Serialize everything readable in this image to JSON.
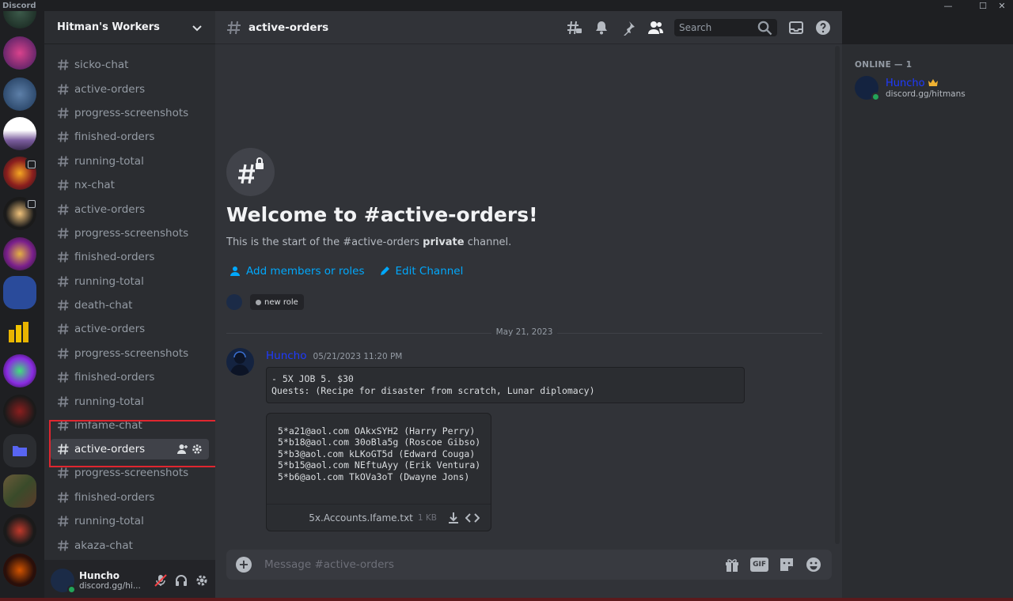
{
  "app": {
    "title": "Discord"
  },
  "guild": {
    "name": "Hitman's Workers"
  },
  "channels": [
    {
      "label": "sicko-chat"
    },
    {
      "label": "active-orders"
    },
    {
      "label": "progress-screenshots"
    },
    {
      "label": "finished-orders"
    },
    {
      "label": "running-total"
    },
    {
      "label": "nx-chat"
    },
    {
      "label": "active-orders"
    },
    {
      "label": "progress-screenshots"
    },
    {
      "label": "finished-orders"
    },
    {
      "label": "running-total"
    },
    {
      "label": "death-chat"
    },
    {
      "label": "active-orders"
    },
    {
      "label": "progress-screenshots"
    },
    {
      "label": "finished-orders"
    },
    {
      "label": "running-total"
    },
    {
      "label": "imfame-chat"
    },
    {
      "label": "active-orders",
      "active": true
    },
    {
      "label": "progress-screenshots"
    },
    {
      "label": "finished-orders"
    },
    {
      "label": "running-total"
    },
    {
      "label": "akaza-chat"
    }
  ],
  "user": {
    "name": "Huncho",
    "status": "discord.gg/hi..."
  },
  "header": {
    "channel": "active-orders",
    "search_placeholder": "Search"
  },
  "welcome": {
    "title": "Welcome to #active-orders!",
    "sub_prefix": "This is the start of the #active-orders ",
    "sub_bold": "private",
    "sub_suffix": " channel.",
    "add_members": "Add members or roles",
    "edit_channel": "Edit Channel",
    "role": "new role"
  },
  "date_divider": "May 21, 2023",
  "message": {
    "author": "Huncho",
    "timestamp": "05/21/2023 11:20 PM",
    "code": "- 5X JOB 5. $30\nQuests: (Recipe for disaster from scratch, Lunar diplomacy)",
    "attachment_preview": "5*a21@aol.com OAkxSYH2 (Harry Perry)\n5*b18@aol.com 30oBla5g (Roscoe Gibso)\n5*b3@aol.com kLKoGT5d (Edward Couga)\n5*b15@aol.com NEftuAyy (Erik Ventura)\n5*b6@aol.com TkOVa3oT (Dwayne Jons)",
    "attachment_name": "5x.Accounts.Ifame.txt",
    "attachment_size": "1 KB"
  },
  "composer": {
    "placeholder": "Message #active-orders",
    "gif": "GIF"
  },
  "members": {
    "header": "ONLINE — 1",
    "list": [
      {
        "name": "Huncho",
        "status": "discord.gg/hitmans"
      }
    ]
  },
  "colors": {
    "accent": "#00a8fc",
    "author": "#1e3aff",
    "online": "#23a559",
    "highlight": "#e0262f"
  }
}
